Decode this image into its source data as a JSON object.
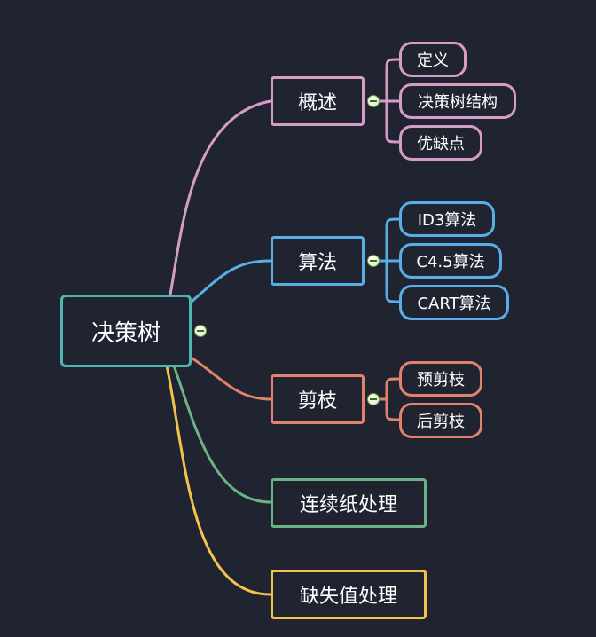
{
  "colors": {
    "background": "#1f2430",
    "root": "#4fb5b0",
    "overview": "#d69cc8",
    "algorithm": "#5aaee6",
    "pruning": "#e0826e",
    "continuous": "#6db286",
    "missing": "#f2c14e"
  },
  "root": {
    "label": "决策树"
  },
  "branches": [
    {
      "label": "概述",
      "children": [
        {
          "label": "定义"
        },
        {
          "label": "决策树结构"
        },
        {
          "label": "优缺点"
        }
      ]
    },
    {
      "label": "算法",
      "children": [
        {
          "label": "ID3算法"
        },
        {
          "label": "C4.5算法"
        },
        {
          "label": "CART算法"
        }
      ]
    },
    {
      "label": "剪枝",
      "children": [
        {
          "label": "预剪枝"
        },
        {
          "label": "后剪枝"
        }
      ]
    },
    {
      "label": "连续纸处理",
      "children": []
    },
    {
      "label": "缺失值处理",
      "children": []
    }
  ]
}
